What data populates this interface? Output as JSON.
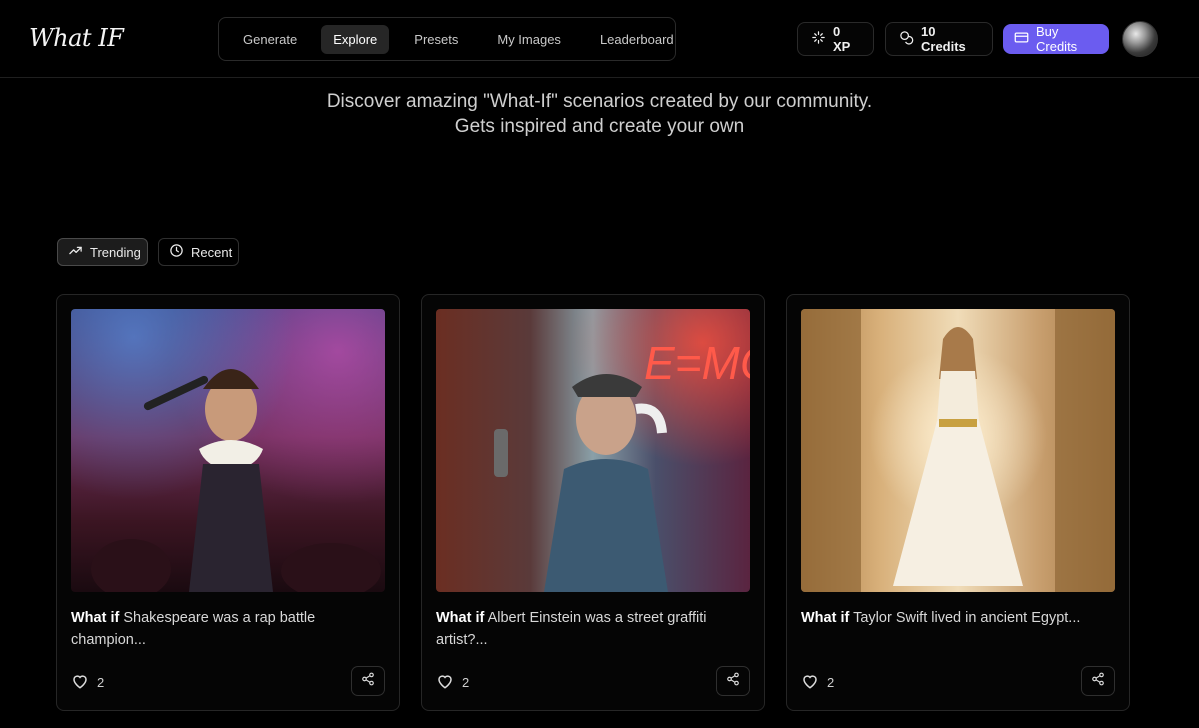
{
  "app": {
    "logo": "What IF"
  },
  "nav": {
    "items": [
      {
        "label": "Generate",
        "active": false
      },
      {
        "label": "Explore",
        "active": true
      },
      {
        "label": "Presets",
        "active": false
      },
      {
        "label": "My Images",
        "active": false
      },
      {
        "label": "Leaderboard",
        "active": false
      }
    ]
  },
  "header": {
    "xp_label": "0 XP",
    "credits_label": "10 Credits",
    "buy_label": "Buy Credits",
    "accent": "#6b5cf0"
  },
  "hero": {
    "line1": "Discover amazing \"What-If\" scenarios created by our community.",
    "line2": "Gets inspired and create your own"
  },
  "filters": {
    "trending_label": "Trending",
    "recent_label": "Recent"
  },
  "cards": [
    {
      "prefix": "What if",
      "text": "Shakespeare was a rap battle champion...",
      "likes": "2",
      "image": "shakespeare-rap-battle"
    },
    {
      "prefix": "What if",
      "text": "Albert Einstein was a street graffiti artist?...",
      "likes": "2",
      "image": "einstein-graffiti-artist"
    },
    {
      "prefix": "What if",
      "text": "Taylor Swift lived in ancient Egypt...",
      "likes": "2",
      "image": "taylor-swift-egypt"
    }
  ]
}
